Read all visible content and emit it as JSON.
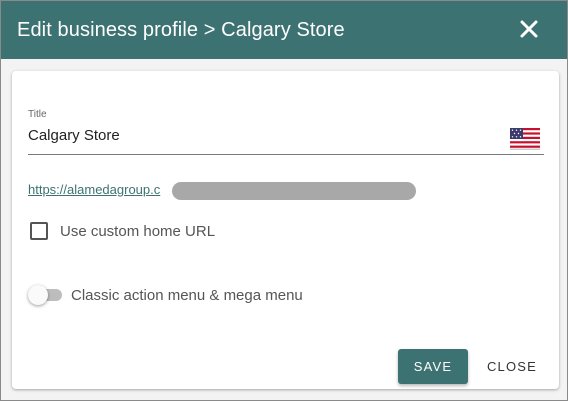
{
  "dialog": {
    "title": "Edit business profile > Calgary Store",
    "close_icon": "close-icon"
  },
  "form": {
    "title_field": {
      "label": "Title",
      "value": "Calgary Store",
      "flag_icon": "us-flag-icon"
    },
    "url": {
      "text": "https://alamedagroup.c"
    },
    "custom_home_url": {
      "label": "Use custom home URL",
      "checked": false
    },
    "classic_menu": {
      "label": "Classic action menu & mega menu",
      "enabled": false
    }
  },
  "actions": {
    "save_label": "SAVE",
    "close_label": "CLOSE"
  },
  "colors": {
    "accent": "#3d7272",
    "toggle_off": "#bdbdbd"
  }
}
